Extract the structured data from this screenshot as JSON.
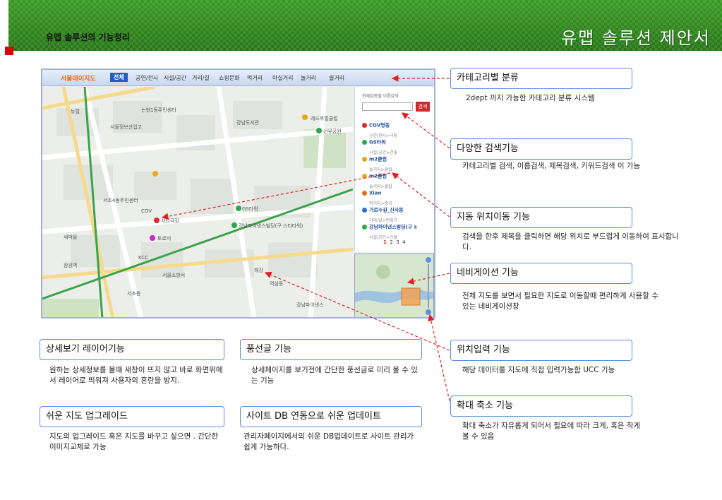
{
  "header": {
    "subtitle": "유맵 솔루션의 기능정리",
    "title": "유맵 솔루션 제안서"
  },
  "map": {
    "brand": "서울데이지도",
    "categories": [
      "전체",
      "공연/전시",
      "시설/공간",
      "거리/길",
      "쇼핑문화",
      "먹거리",
      "마실거리",
      "놀거리",
      "쉴거리"
    ],
    "active_category": "전체",
    "labels": {
      "road1": "뉴힐",
      "seoul_school": "서울정보산업고",
      "nonhyeon": "논현1동주민센터",
      "gangnam_a": "강남도서관",
      "cgv_label": "CGV",
      "redflag": "레드후얼클럽",
      "seonyu": "선유공원",
      "gs": "GS타워",
      "cityhall": "시티극장",
      "toreomi": "토로미",
      "gangnam_b": "강남파이낸스빌딩(구 스타타워)",
      "yeoksam": "역삼동",
      "haegang": "해강",
      "seochon": "서초4동주민센터",
      "jamwon": "잠원역",
      "gangnam_finance": "강남파이낸스",
      "kcc": "KCC",
      "seocho": "서초동",
      "fire": "서울소방서",
      "saemaul": "새마을"
    },
    "side_panel": {
      "title": "현재검증별 이름검색",
      "search_button": "검색",
      "items": [
        {
          "name": "CGV명동",
          "sub": "공연/전시>극장",
          "color": "#d92b2b"
        },
        {
          "name": "GS타워",
          "sub": "시설/공간>건물",
          "color": "#2aa84a"
        },
        {
          "name": "m2클럽",
          "sub": "놀거리>클럽",
          "color": "#e6a91e"
        },
        {
          "name": "m2클럽",
          "sub": "놀거리>클럽",
          "color": "#e6a91e"
        },
        {
          "name": "Xian",
          "sub": "먹거리>중국",
          "color": "#ec6c1b"
        },
        {
          "name": "가로수길_신사동",
          "sub": "거리/길>번화가",
          "color": "#2a6bd1"
        },
        {
          "name": "강남파이낸스빌딩(구 s",
          "sub": "시설/공간>건물",
          "color": "#2aa84a"
        }
      ],
      "pages": [
        "1",
        "2",
        "3",
        "4"
      ],
      "current_page": "1"
    }
  },
  "callouts": [
    {
      "title": "카테고리별 분류",
      "desc": "2dept 까지 가능한 카테고리 분류 시스템"
    },
    {
      "title": "다양한 검색기능",
      "desc": "카테고리별 검색, 이름검색, 제목검색, 키워드검색 이 가능"
    },
    {
      "title": "지동 위치이동 기능",
      "desc": "검색을 한후 제목을 클릭하면 해당 위치로 부드럽게 이동하여 표시합니다."
    },
    {
      "title": "네비게이션 기능",
      "desc": "전체 지도를 보면서 필요한 지도로 이동할때 편리하게 사용할 수 있는 네비게이션창"
    },
    {
      "title": "위치입력 기능",
      "desc": "해당 데이터를 지도에 직접 입력가능함 UCC 기능"
    },
    {
      "title": "확대 축소 기능",
      "desc": "확대 축소가 자유롭게 되어서 필요에 따라 크게, 혹은 작게 볼 수 있음"
    }
  ],
  "features": [
    {
      "title": "상세보기 레이어기능",
      "desc": "원하는 상세정보를 볼때 새창이 뜨지 않고 바로 화면위에서 레이어로 띄워져 사용자의 혼란을 방지."
    },
    {
      "title": "풍선글 기능",
      "desc": "상세페이지를 보기전에 간단한 풍선글로 미리 볼 수 있는 기능"
    },
    {
      "title": "쉬운 지도 업그레이드",
      "desc": "지도의 업그레이드 혹은 지도를 바꾸고 싶으면 . 간단한 이미지교체로 가능"
    },
    {
      "title": "사이트 DB 연동으로 쉬운 업데이트",
      "desc": "관리자페이지에서의 쉬운 DB업데이트로 사이트 관리가 쉽게 가능하다."
    }
  ],
  "colors": {
    "header_green": "#2f8f1f",
    "callout_border": "#5a8ee0",
    "arrow_red": "#e02020",
    "accent_red": "#e00000"
  }
}
